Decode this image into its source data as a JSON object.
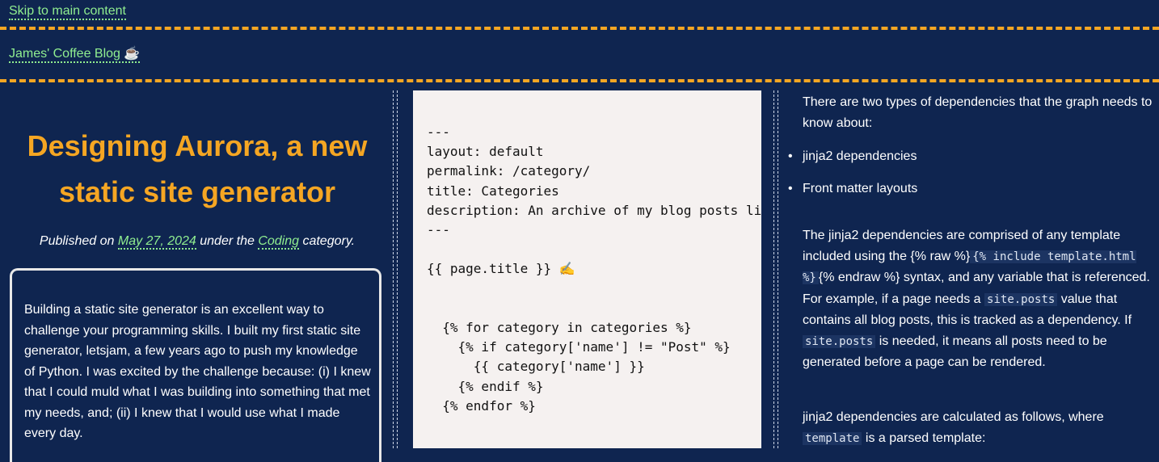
{
  "skip_link": "Skip to main content",
  "site": {
    "title": "James' Coffee Blog ☕"
  },
  "post": {
    "title": "Designing Aurora, a new static site generator",
    "meta": {
      "prefix": "Published on ",
      "date": "May 27, 2024",
      "middle": " under the ",
      "category": "Coding",
      "suffix": " category."
    },
    "intro": "Building a static site generator is an excellent way to challenge your programming skills. I built my first static site generator, letsjam, a few years ago to push my knowledge of Python. I was excited by the challenge because: (i) I knew that I could muld what I was building into something that met my needs, and; (ii) I knew that I would use what I made every day."
  },
  "code_block": "---\nlayout: default\npermalink: /category/\ntitle: Categories\ndescription: An archive of my blog posts listed by category\n---\n\n{{ page.title }} ✍️\n\n\n  {% for category in categories %}\n    {% if category['name'] != \"Post\" %}\n      {{ category['name'] }}\n    {% endif %}\n  {% endfor %}",
  "right": {
    "para1": "There are two types of dependencies that the graph needs to know about:",
    "bullets": [
      "jinja2 dependencies",
      "Front matter layouts"
    ],
    "para2": {
      "t1": "The jinja2 dependencies are comprised of any template included using the {% raw %}",
      "c1": "{% include template.html %}",
      "t2": "{% endraw %} syntax, and any variable that is referenced. For example, if a page needs a ",
      "c2": "site.posts",
      "t3": " value that contains all blog posts, this is tracked as a dependency. If ",
      "c3": "site.posts",
      "t4": " is needed, it means all posts need to be generated before a page can be rendered."
    },
    "para3": {
      "t1": "jinja2 dependencies are calculated as follows, where ",
      "c1": "template",
      "t2": " is a parsed template:"
    }
  },
  "colors": {
    "background": "#0f2550",
    "accent": "#f5a623",
    "link": "#90ee90",
    "code_bg": "#f5f1f0"
  }
}
